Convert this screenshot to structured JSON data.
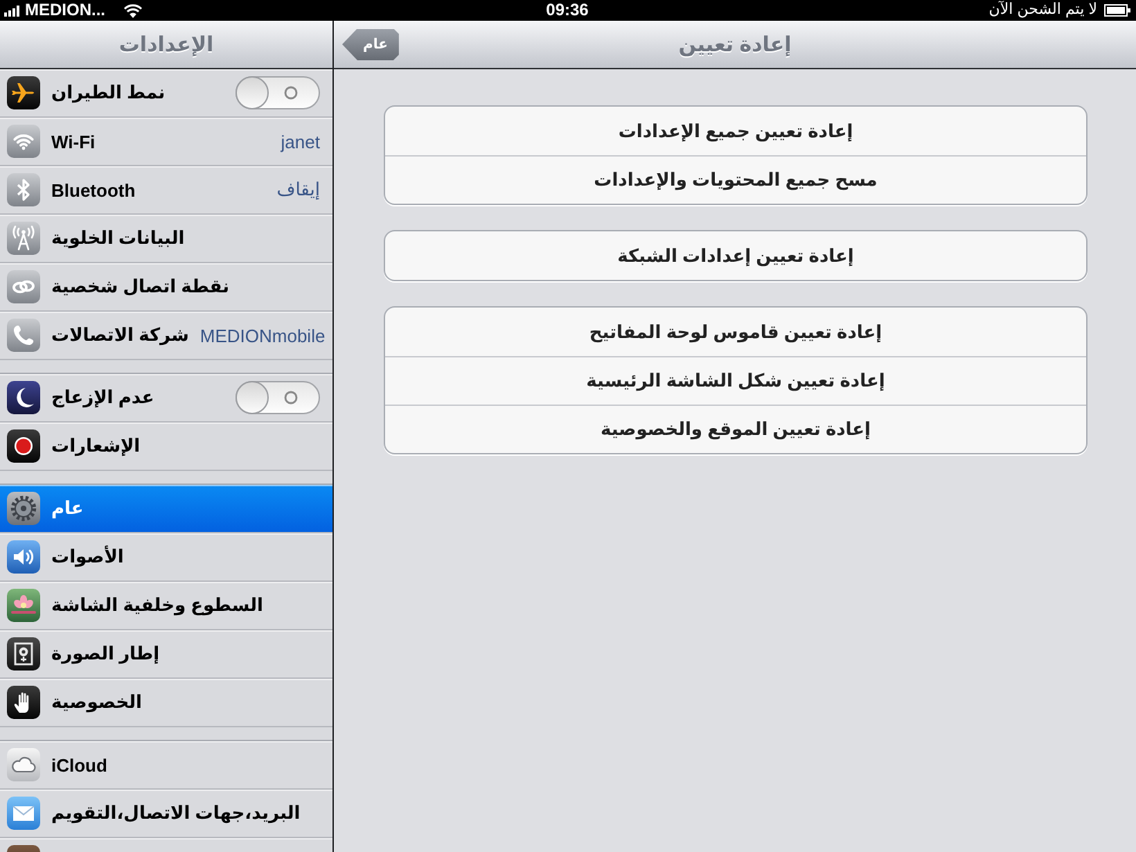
{
  "status_bar": {
    "carrier": "MEDION...",
    "time": "09:36",
    "charging_status": "لا يتم الشحن الآن"
  },
  "sidebar": {
    "title": "الإعدادات",
    "groups": [
      {
        "items": [
          {
            "label": "نمط الطيران",
            "kind": "toggle",
            "on": false,
            "selected": false
          },
          {
            "label": "Wi-Fi",
            "kind": "value",
            "value": "janet",
            "selected": false
          },
          {
            "label": "Bluetooth",
            "kind": "value",
            "value": "إيقاف",
            "selected": false
          },
          {
            "label": "البيانات الخلوية",
            "kind": "plain",
            "selected": false
          },
          {
            "label": "نقطة اتصال شخصية",
            "kind": "plain",
            "selected": false
          },
          {
            "label": "شركة الاتصالات",
            "kind": "value",
            "value": "MEDIONmobile",
            "selected": false
          }
        ]
      },
      {
        "items": [
          {
            "label": "عدم الإزعاج",
            "kind": "toggle",
            "on": false,
            "selected": false
          },
          {
            "label": "الإشعارات",
            "kind": "plain",
            "selected": false
          }
        ]
      },
      {
        "items": [
          {
            "label": "عام",
            "kind": "plain",
            "selected": true
          },
          {
            "label": "الأصوات",
            "kind": "plain",
            "selected": false
          },
          {
            "label": "السطوع وخلفية الشاشة",
            "kind": "plain",
            "selected": false
          },
          {
            "label": "إطار الصورة",
            "kind": "plain",
            "selected": false
          },
          {
            "label": "الخصوصية",
            "kind": "plain",
            "selected": false
          }
        ]
      },
      {
        "items": [
          {
            "label": "iCloud",
            "kind": "plain",
            "selected": false
          },
          {
            "label": "البريد،جهات الاتصال،التقويم",
            "kind": "plain",
            "selected": false
          },
          {
            "kind": "partial",
            "selected": false
          }
        ]
      }
    ]
  },
  "main": {
    "back_button": "عام",
    "title": "إعادة تعيين",
    "groups": [
      {
        "options": [
          "إعادة تعيين جميع الإعدادات",
          "مسح جميع المحتويات والإعدادات"
        ]
      },
      {
        "options": [
          "إعادة تعيين إعدادات الشبكة"
        ]
      },
      {
        "options": [
          "إعادة تعيين قاموس لوحة المفاتيح",
          "إعادة تعيين شكل الشاشة الرئيسية",
          "إعادة تعيين الموقع والخصوصية"
        ]
      }
    ]
  }
}
